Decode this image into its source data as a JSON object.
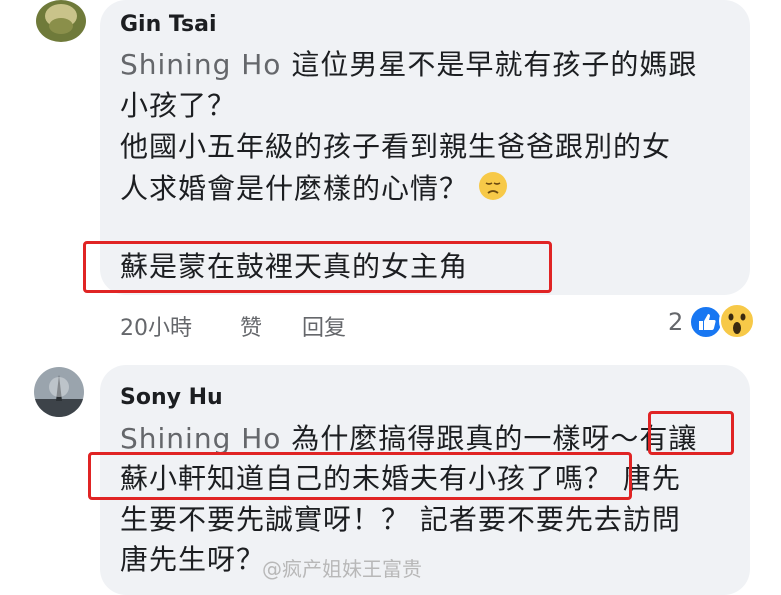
{
  "comments": [
    {
      "author": "Gin Tsai",
      "mention": "Shining Ho",
      "lines": [
        "這位男星不是早就有孩子的媽跟",
        "小孩了？",
        "他國小五年級的孩子看到親生爸爸跟別的女",
        "人求婚會是什麼樣的心情？"
      ],
      "highlight": "蘇是蒙在鼓裡天真的女主角",
      "time": "20小時",
      "like": "赞",
      "reply": "回复",
      "reaction_count": "2",
      "reaction_icons": [
        "like-icon",
        "wow-icon"
      ],
      "emoji": "sad-face-emoji"
    },
    {
      "author": "Sony Hu",
      "mention": "Shining Ho",
      "line1_text": "為什麼搞得跟真的一樣呀～",
      "line1_boxed": "有讓",
      "line2_boxed": "蘇小軒知道自己的未婚夫有小孩了嗎？",
      "line2_rest": "唐先",
      "line3": "生要不要先誠實呀！？ 記者要不要先去訪問",
      "line4": "唐先生呀？"
    }
  ],
  "watermark": "@疯产姐妹王富贵",
  "colors": {
    "highlight_box": "#e02424",
    "bubble": "#f0f2f5",
    "mention": "#65676b"
  }
}
